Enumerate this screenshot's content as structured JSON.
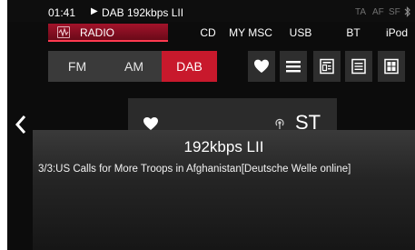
{
  "status": {
    "time": "01:41",
    "play_icon": "play-icon",
    "source": "DAB 192kbps LII",
    "indicators": [
      "TA",
      "AF",
      "SF"
    ],
    "bluetooth_icon": "bluetooth-icon"
  },
  "tabs": [
    {
      "label": "RADIO",
      "icon": "radio-wave-icon",
      "active": true
    },
    {
      "label": "CD"
    },
    {
      "label": "MY MSC"
    },
    {
      "label": "USB"
    },
    {
      "label": "BT"
    },
    {
      "label": "iPod"
    }
  ],
  "bands": [
    {
      "label": "FM"
    },
    {
      "label": "AM"
    },
    {
      "label": "DAB",
      "active": true
    }
  ],
  "view_buttons": [
    "heart-icon",
    "list-icon",
    "detail-icon",
    "text-list-icon",
    "grid-icon"
  ],
  "station_card": {
    "heart_icon": "heart-icon",
    "antenna_icon": "antenna-icon",
    "label": "ST"
  },
  "info_overlay": {
    "channel": "192kbps LII",
    "dls_text": "3/3:US Calls for More Troops in Afghanistan[Deutsche Welle online]"
  },
  "colors": {
    "accent": "#c8192c",
    "background": "#0c0c0c",
    "button": "#3a3a3a"
  }
}
